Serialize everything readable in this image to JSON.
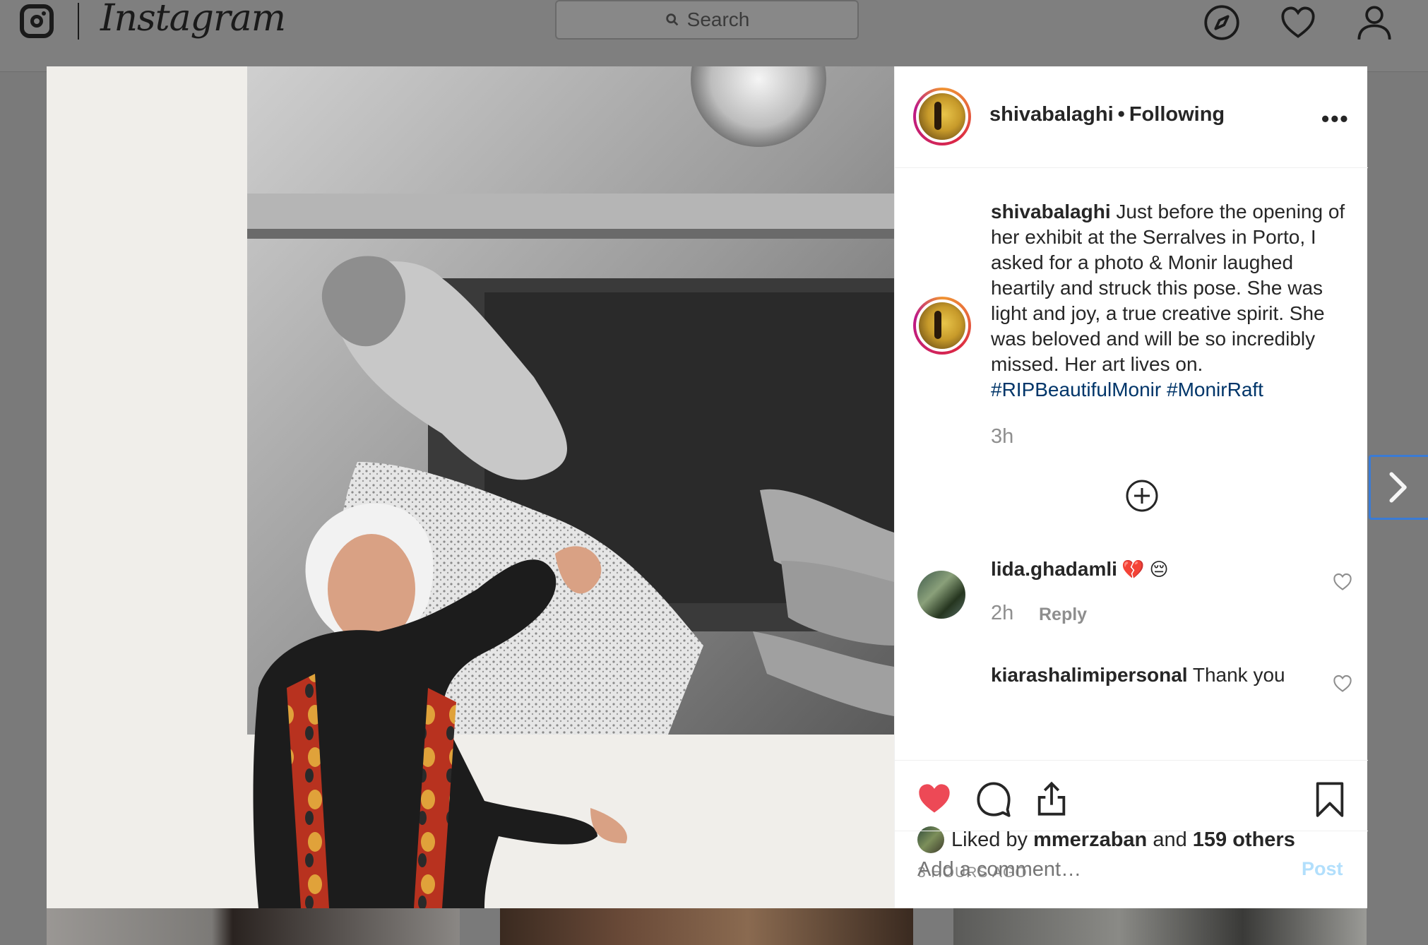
{
  "nav": {
    "logo_icon": "instagram-glyph-icon",
    "wordmark": "Instagram",
    "search_placeholder": "Search",
    "icons": [
      "explore-compass-icon",
      "heart-icon",
      "profile-icon"
    ]
  },
  "post": {
    "author": "shivabalaghi",
    "separator": "•",
    "follow_status": "Following",
    "more_label": "•••",
    "caption_user": "shivabalaghi",
    "caption_text": "Just before the opening of her exhibit at the Serralves in Porto, I asked for a photo & Monir laughed heartily and struck this pose. She was light and joy, a true creative spirit. She was beloved and will be so incredibly missed. Her art lives on.",
    "hashtags": "#RIPBeautifulMonir #MonirRaft",
    "caption_time": "3h",
    "comments": [
      {
        "user": "lida.ghadamli",
        "text": "💔 😔",
        "time": "2h",
        "reply": "Reply"
      },
      {
        "user": "kiarashalimipersonal",
        "text": "Thank you"
      }
    ],
    "likes_prefix": "Liked by",
    "likes_user": "mmerzaban",
    "likes_and": "and",
    "likes_others": "159 others",
    "posted_ago": "3 HOURS AGO",
    "comment_placeholder": "Add a comment…",
    "post_button": "Post",
    "liked": true
  },
  "colors": {
    "like_red": "#ed4956",
    "hashtag_blue": "#003569",
    "post_disabled": "#b2dffc",
    "overlay": "#7a7a7a",
    "next_focus": "#3a7bd5"
  }
}
